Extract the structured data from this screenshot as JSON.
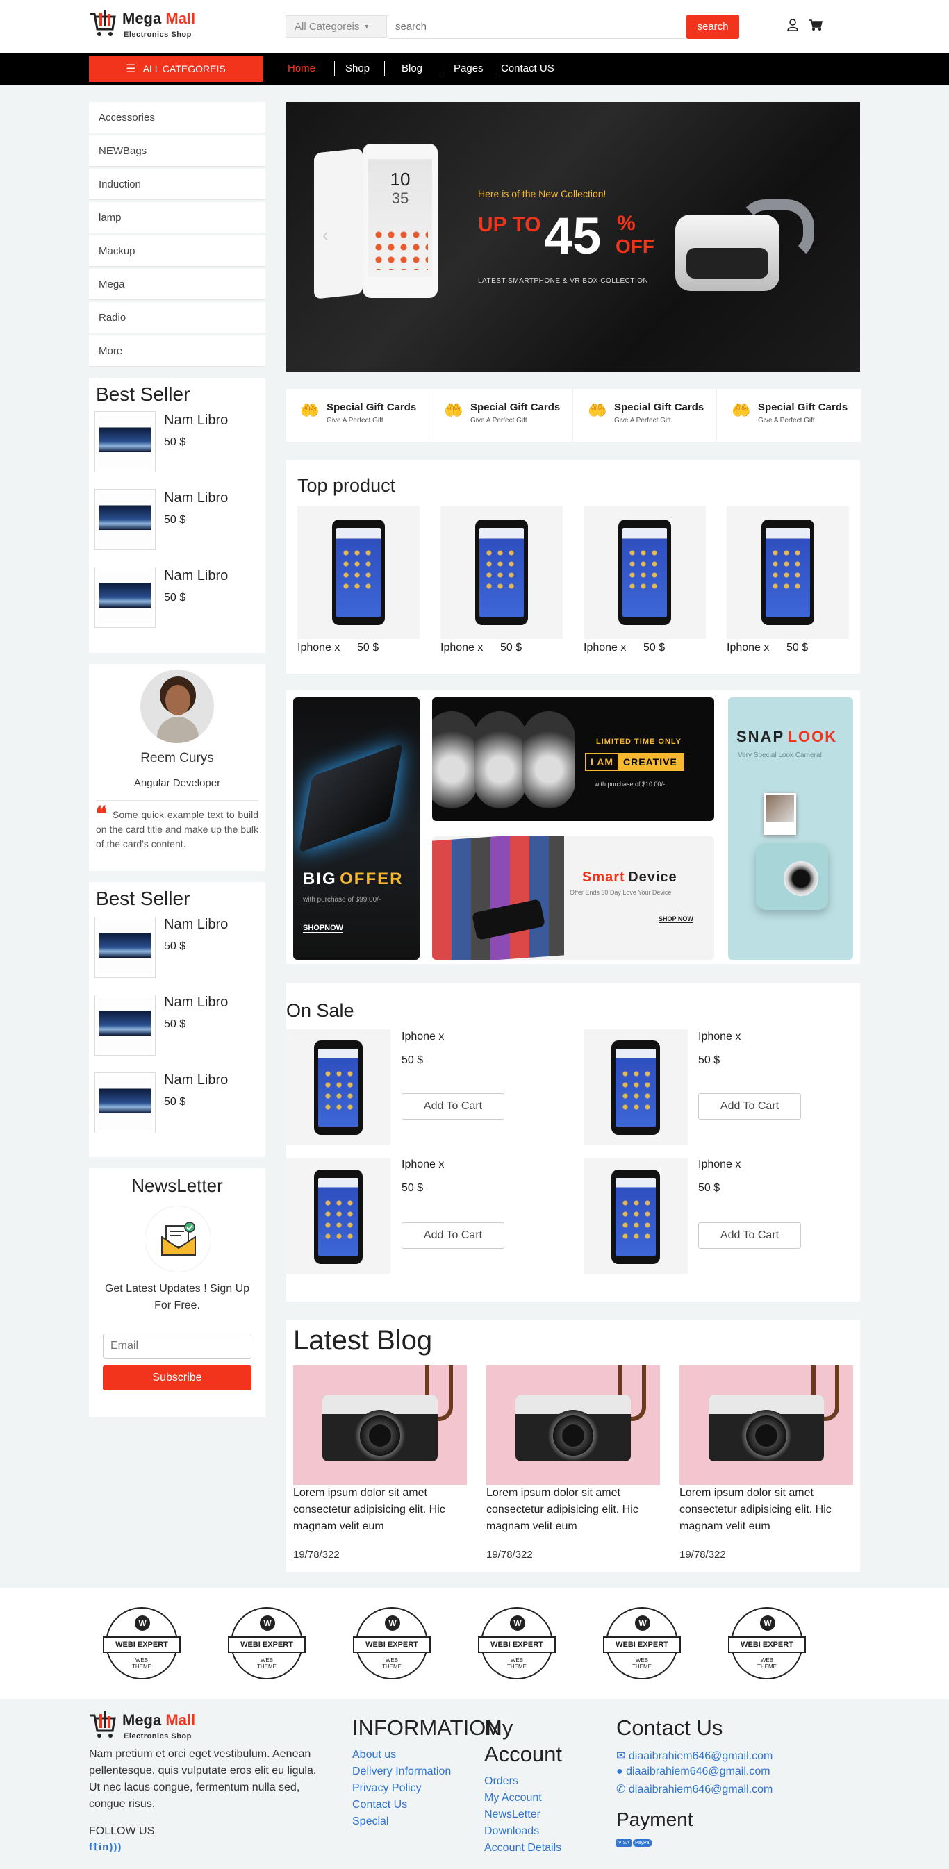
{
  "brand": {
    "name_a": "Mega",
    "name_b": "Mall",
    "tagline": "Electronics Shop"
  },
  "search": {
    "category_label": "All Categoreis",
    "placeholder": "search",
    "button": "search"
  },
  "nav": {
    "all_categories": "ALL CATEGOREIS",
    "links": [
      "Home",
      "Shop",
      "Blog",
      "Pages",
      "Contact US"
    ],
    "active": "Home"
  },
  "categories": [
    "Accessories",
    "NEWBags",
    "Induction",
    "lamp",
    "Mackup",
    "Mega",
    "Radio",
    "More"
  ],
  "best_seller_1": {
    "title": "Best Seller",
    "items": [
      {
        "name": "Nam Libro",
        "price": "50 $"
      },
      {
        "name": "Nam Libro",
        "price": "50 $"
      },
      {
        "name": "Nam Libro",
        "price": "50 $"
      }
    ]
  },
  "profile": {
    "name": "Reem Curys",
    "role": "Angular Developer",
    "quote": "Some quick example text to build on the card title and make up the bulk of the card's content."
  },
  "best_seller_2": {
    "title": "Best Seller",
    "items": [
      {
        "name": "Nam Libro",
        "price": "50 $"
      },
      {
        "name": "Nam Libro",
        "price": "50 $"
      },
      {
        "name": "Nam Libro",
        "price": "50 $"
      }
    ]
  },
  "newsletter": {
    "title": "NewsLetter",
    "text": "Get Latest Updates ! Sign Up For Free.",
    "placeholder": "Email",
    "button": "Subscribe"
  },
  "hero": {
    "line1": "Here is  of the  New Collection!",
    "upto": "UP TO",
    "pct": "45",
    "pct_sign": "%",
    "off": "OFF",
    "line2": "LATEST SMARTPHONE & VR BOX COLLECTION",
    "phone_time": "10",
    "phone_min": "35"
  },
  "gifts": [
    {
      "title": "Special Gift Cards",
      "sub": "Give A Perfect Gift"
    },
    {
      "title": "Special Gift Cards",
      "sub": "Give A Perfect Gift"
    },
    {
      "title": "Special Gift Cards",
      "sub": "Give A Perfect Gift"
    },
    {
      "title": "Special Gift Cards",
      "sub": "Give A Perfect Gift"
    }
  ],
  "top_product": {
    "title": "Top product",
    "items": [
      {
        "name": "Iphone x",
        "price": "50 $"
      },
      {
        "name": "Iphone x",
        "price": "50 $"
      },
      {
        "name": "Iphone x",
        "price": "50 $"
      },
      {
        "name": "Iphone x",
        "price": "50 $"
      }
    ]
  },
  "promos": {
    "big_offer": {
      "word1": "BIG",
      "word2": "OFFER",
      "sub": "with purchase of $99.00/-",
      "cta": "SHOPNOW"
    },
    "creative": {
      "top": "LIMITED TIME ONLY",
      "i_am": "I AM",
      "creative": "CREATIVE",
      "sub": "with purchase of $10.00/-"
    },
    "smart": {
      "word1": "Smart",
      "word2": "Device",
      "sub": "Offer Ends 30 Day Love Your Device",
      "cta": "SHOP NOW"
    },
    "snap": {
      "word1": "SNAP",
      "word2": "LOOK",
      "sub": "Very Special Look Camera!"
    }
  },
  "on_sale": {
    "title": "On Sale",
    "add_label": "Add To Cart",
    "items": [
      {
        "name": "Iphone x",
        "price": "50 $"
      },
      {
        "name": "Iphone x",
        "price": "50 $"
      },
      {
        "name": "Iphone x",
        "price": "50 $"
      },
      {
        "name": "Iphone x",
        "price": "50 $"
      }
    ]
  },
  "blog": {
    "title": "Latest Blog",
    "posts": [
      {
        "text": "Lorem ipsum dolor sit amet consectetur adipisicing elit. Hic magnam velit eum",
        "date": "19/78/322"
      },
      {
        "text": "Lorem ipsum dolor sit amet consectetur adipisicing elit. Hic magnam velit eum",
        "date": "19/78/322"
      },
      {
        "text": "Lorem ipsum dolor sit amet consectetur adipisicing elit. Hic magnam velit eum",
        "date": "19/78/322"
      }
    ]
  },
  "brands": {
    "label": "WEBI EXPERT",
    "sub1": "WEB",
    "sub2": "THEME"
  },
  "footer": {
    "about": "Nam pretium et orci eget vestibulum. Aenean pellentesque, quis vulputate eros elit eu ligula. Ut nec lacus congue, fermentum nulla sed, congue risus.",
    "follow": "FOLLOW US",
    "info_title": "INFORMATION",
    "info_links": [
      "About us",
      "Delivery Information",
      "Privacy Policy",
      "Contact Us",
      "Special"
    ],
    "account_title_1": "My",
    "account_title_2": "Account",
    "account_links": [
      "Orders",
      "My Account",
      "NewsLetter",
      "Downloads",
      "Account Details"
    ],
    "contact_title": "Contact Us",
    "contacts": [
      "diaaibrahiem646@gmail.com",
      "diaaibrahiem646@gmail.com",
      "diaaibrahiem646@gmail.com"
    ],
    "payment_title": "Payment",
    "payment_cards": [
      "VISA",
      "PayPal"
    ]
  },
  "colors": {
    "accent": "#f2341d",
    "link": "#2f74d0",
    "nav_bg": "#000000"
  }
}
